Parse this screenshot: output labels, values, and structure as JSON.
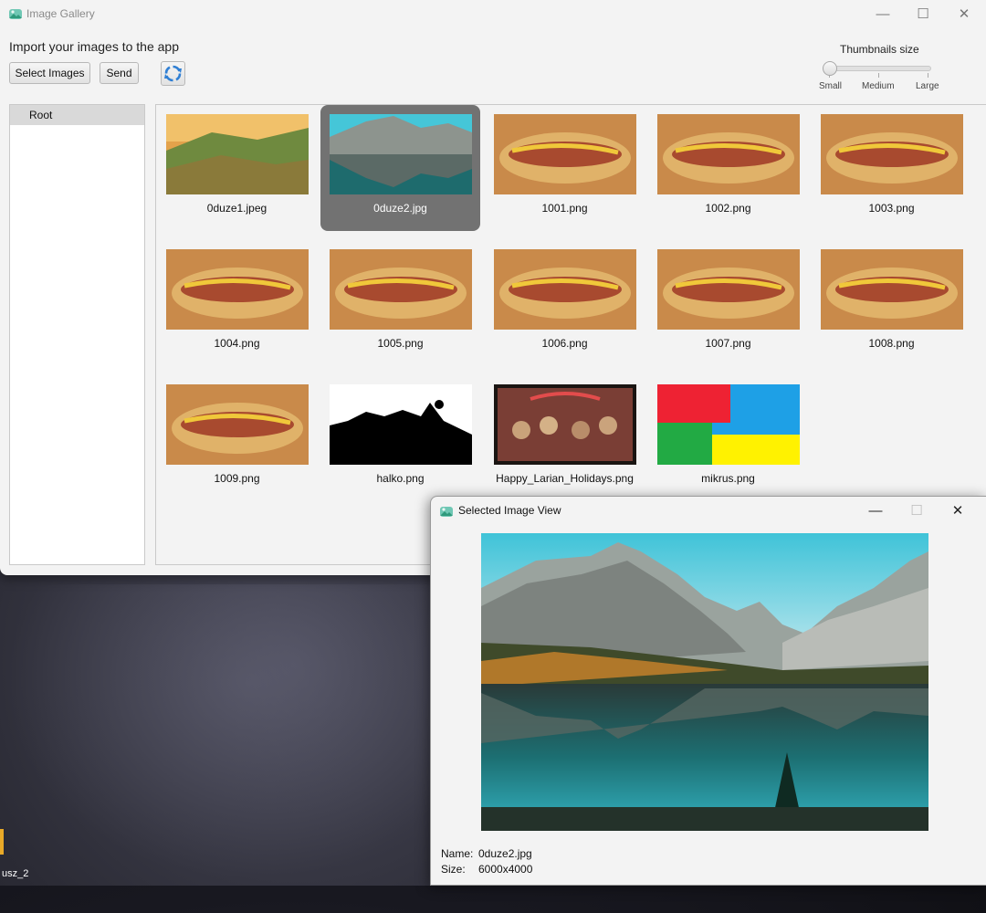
{
  "window": {
    "title": "Image Gallery",
    "controls": {
      "minimize": "—",
      "maximize": "☐",
      "close": "✕"
    }
  },
  "toolbar": {
    "import_label": "Import your images to the app",
    "select_label": "Select Images",
    "send_label": "Send",
    "refresh_icon": "refresh-icon"
  },
  "thumbnail_size": {
    "title": "Thumbnails size",
    "ticks": [
      "Small",
      "Medium",
      "Large"
    ],
    "selected": "Small"
  },
  "tree": {
    "root_label": "Root"
  },
  "gallery": {
    "selected_index": 1,
    "items": [
      {
        "name": "0duze1.jpeg",
        "kind": "hills"
      },
      {
        "name": "0duze2.jpg",
        "kind": "lake"
      },
      {
        "name": "1001.png",
        "kind": "hotdog"
      },
      {
        "name": "1002.png",
        "kind": "hotdog"
      },
      {
        "name": "1003.png",
        "kind": "hotdog"
      },
      {
        "name": "1004.png",
        "kind": "hotdog"
      },
      {
        "name": "1005.png",
        "kind": "hotdog"
      },
      {
        "name": "1006.png",
        "kind": "hotdog"
      },
      {
        "name": "1007.png",
        "kind": "hotdog"
      },
      {
        "name": "1008.png",
        "kind": "hotdog"
      },
      {
        "name": "1009.png",
        "kind": "hotdog"
      },
      {
        "name": "halko.png",
        "kind": "mask"
      },
      {
        "name": "Happy_Larian_Holidays.png",
        "kind": "holiday"
      },
      {
        "name": "mikrus.png",
        "kind": "colorblocks"
      }
    ]
  },
  "viewer": {
    "title": "Selected Image View",
    "controls": {
      "minimize": "—",
      "maximize": "☐",
      "close": "✕"
    },
    "name_key": "Name:",
    "name_value": "0duze2.jpg",
    "size_key": "Size:",
    "size_value": "6000x4000"
  },
  "desktop": {
    "icon_label": "usz_2"
  },
  "colors": {
    "window_bg": "#f3f3f3",
    "selected_tile": "#727272",
    "refresh_blue": "#2f7fd4"
  }
}
